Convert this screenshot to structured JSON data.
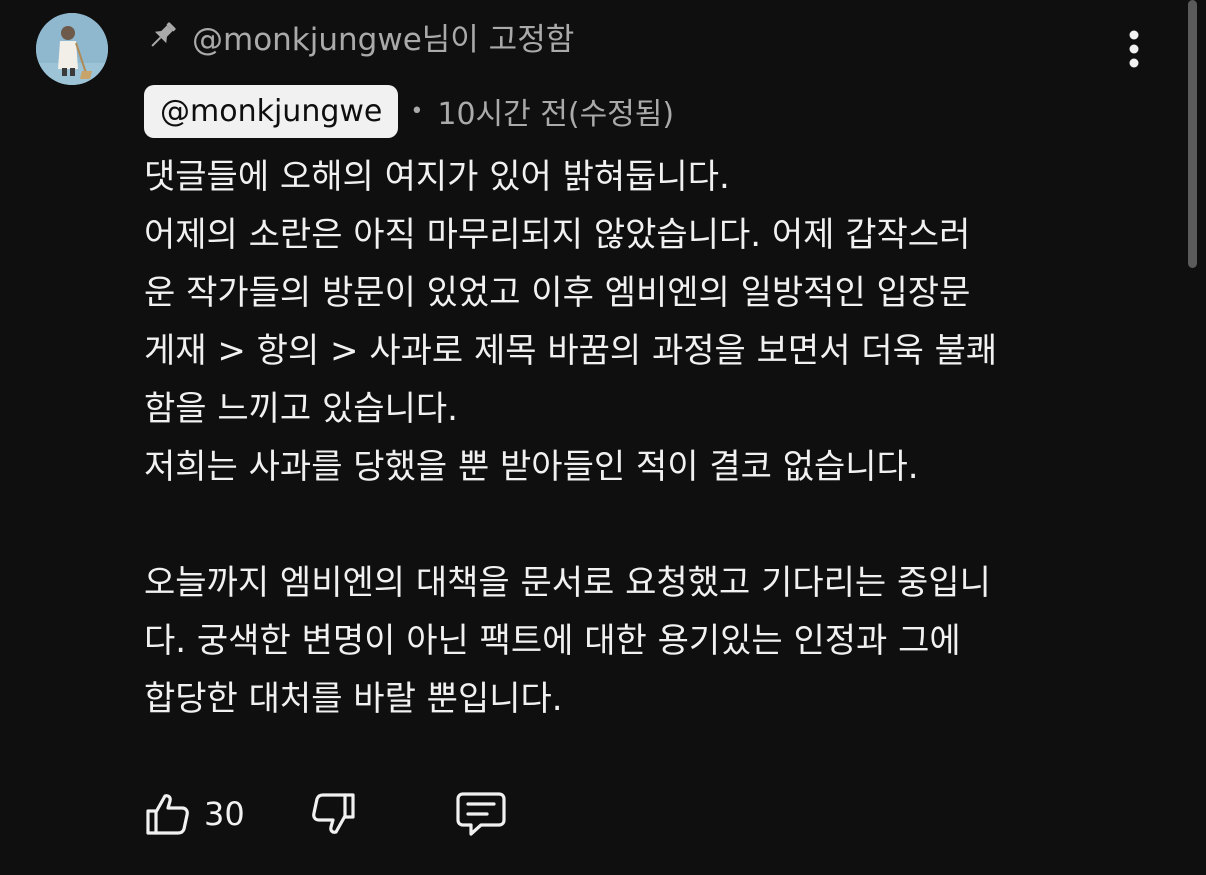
{
  "pinned": {
    "icon": "pin-icon",
    "text": "@monkjungwe님이 고정함"
  },
  "comment": {
    "avatar_icon": "avatar-image",
    "author": "@monkjungwe",
    "separator": "•",
    "timestamp": "10시간 전(수정됨)",
    "lines": [
      "댓글들에 오해의 여지가 있어 밝혀둡니다.",
      "어제의 소란은 아직 마무리되지 않았습니다. 어제 갑작스러",
      "운 작가들의 방문이 있었고 이후 엠비엔의 일방적인 입장문",
      "게재 > 항의 > 사과로 제목 바꿈의 과정을 보면서 더욱 불쾌",
      "함을 느끼고 있습니다.",
      "저희는 사과를 당했을 뿐 받아들인 적이 결코 없습니다.",
      "",
      "오늘까지 엠비엔의 대책을 문서로 요청했고 기다리는 중입니",
      "다. 궁색한 변명이 아닌 팩트에 대한 용기있는 인정과 그에",
      "합당한 대처를 바랄 뿐입니다."
    ]
  },
  "actions": {
    "like_icon": "thumbs-up-icon",
    "like_count": "30",
    "dislike_icon": "thumbs-down-icon",
    "reply_icon": "reply-comment-icon"
  },
  "menu_icon": "more-vertical-icon",
  "colors": {
    "background": "#0f0f0f",
    "text_primary": "#f1f1f1",
    "text_secondary": "#aaaaaa",
    "author_chip_bg": "#f1f1f1"
  }
}
